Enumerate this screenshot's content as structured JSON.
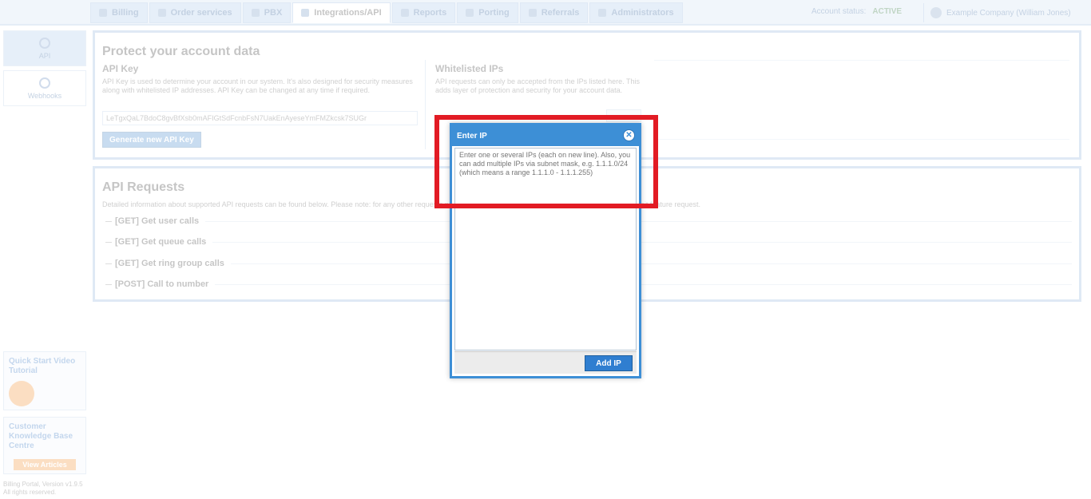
{
  "topbar": {
    "tabs": [
      {
        "label": "Billing",
        "icon": "wallet-icon"
      },
      {
        "label": "Order services",
        "icon": "cart-icon"
      },
      {
        "label": "PBX",
        "icon": "pbx-icon"
      },
      {
        "label": "Integrations/API",
        "icon": "gear-icon",
        "active": true
      },
      {
        "label": "Reports",
        "icon": "chart-icon"
      },
      {
        "label": "Porting",
        "icon": "document-icon"
      },
      {
        "label": "Referrals",
        "icon": "warning-icon"
      },
      {
        "label": "Administrators",
        "icon": "person-icon"
      }
    ],
    "account_status_label": "Account status:",
    "account_status_value": "ACTIVE",
    "user_name": "Example Company (William Jones)"
  },
  "sidebar": {
    "items": [
      {
        "label": "API"
      },
      {
        "label": "Webhooks"
      }
    ],
    "promo_quickstart": "Quick Start Video Tutorial",
    "promo_knowledge": "Customer Knowledge Base Centre",
    "promo_knowledge_button": "View Articles",
    "footer_line1": "Billing Portal, Version v1.9.5",
    "footer_line2": "All rights reserved."
  },
  "protect": {
    "title": "Protect your account data",
    "api_key_heading": "API Key",
    "api_key_desc": "API Key is used to determine your account in our system. It's also designed for security measures along with whitelisted IP addresses. API Key can be changed at any time if required.",
    "api_key_value": "LeTgxQaL7BdoC8gvBfXsb0mAFIGtSdFcnbFsN7UakEnAyeseYmFMZkcsk7SUGr",
    "generate_button": "Generate new API Key",
    "whitelist_heading": "Whitelisted IPs",
    "whitelist_desc": "API requests can only be accepted from the IPs listed here. This adds layer of protection and security for your account data."
  },
  "requests": {
    "title": "API Requests",
    "desc": "Detailed information about supported API requests can be found below. Please note: for any other requests not listed here, please contact our support department to submit feature request.",
    "items": [
      "[GET] Get user calls",
      "[GET] Get queue calls",
      "[GET] Get ring group calls",
      "[POST] Call to number"
    ]
  },
  "modal": {
    "title": "Enter IP",
    "placeholder": "Enter one or several IPs (each on new line). Also, you can add multiple IPs via subnet mask, e.g. 1.1.1.0/24 (which means a range 1.1.1.0 - 1.1.1.255)",
    "add_button": "Add IP"
  },
  "colors": {
    "accent": "#3d8fd6",
    "highlight": "#e21b24"
  }
}
